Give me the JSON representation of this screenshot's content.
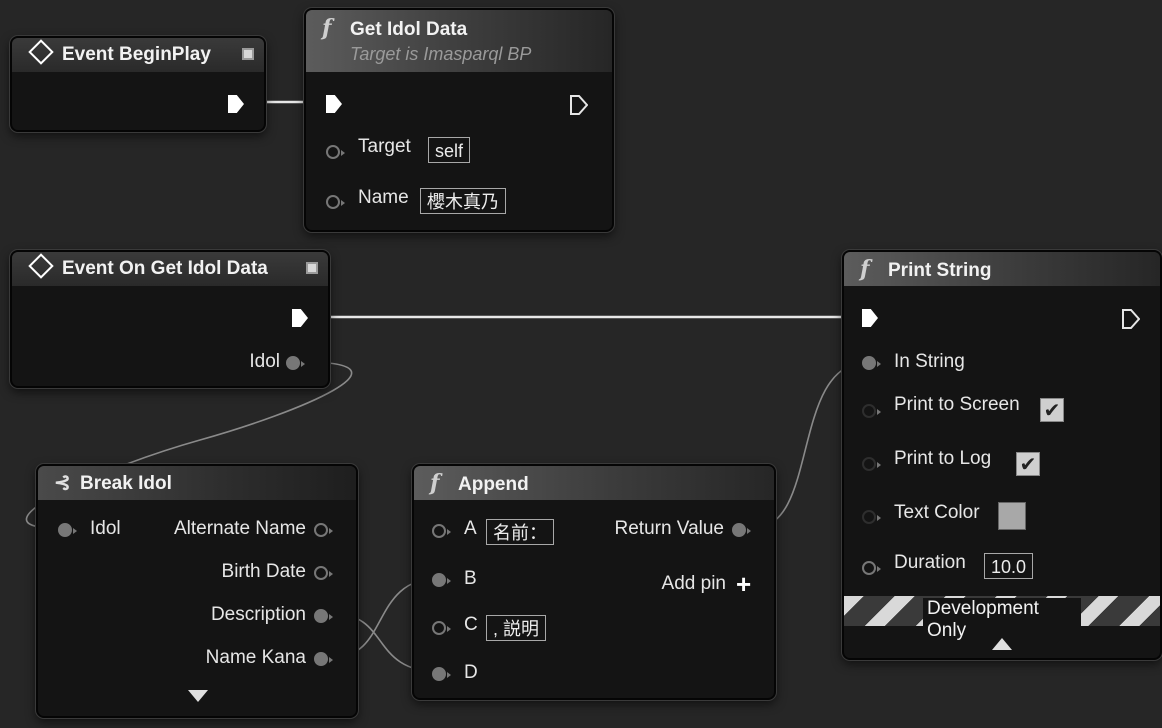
{
  "nodes": {
    "begin_play": {
      "title": "Event BeginPlay"
    },
    "get_idol_data": {
      "title": "Get Idol Data",
      "subtitle": "Target is Imasparql BP",
      "target_label": "Target",
      "target_value": "self",
      "name_label": "Name",
      "name_value": "櫻木真乃"
    },
    "on_get_idol_data": {
      "title": "Event On Get Idol Data",
      "idol_label": "Idol"
    },
    "print_string": {
      "title": "Print String",
      "in_string_label": "In String",
      "print_to_screen_label": "Print to Screen",
      "print_to_screen_checked": true,
      "print_to_log_label": "Print to Log",
      "print_to_log_checked": true,
      "text_color_label": "Text Color",
      "text_color_value": "#a8a8a8",
      "duration_label": "Duration",
      "duration_value": "10.0",
      "dev_only_label": "Development Only"
    },
    "break_idol": {
      "title": "Break Idol",
      "idol_label": "Idol",
      "alternate_name_label": "Alternate Name",
      "birth_date_label": "Birth Date",
      "description_label": "Description",
      "name_kana_label": "Name Kana"
    },
    "append": {
      "title": "Append",
      "a_label": "A",
      "a_value": "名前：",
      "b_label": "B",
      "c_label": "C",
      "c_value": ", 説明",
      "d_label": "D",
      "return_value_label": "Return Value",
      "add_pin_label": "Add pin"
    }
  },
  "icons": {
    "event": "diamond-icon",
    "function": "function-f-icon",
    "break": "break-struct-icon",
    "delegate": "delegate-square-icon",
    "add": "plus-icon",
    "expand": "triangle-down-icon",
    "collapse": "triangle-up-icon"
  },
  "colors": {
    "background": "#262626",
    "node_body": "#141414",
    "wire": "#e8e8e8",
    "data_pin": "#777777"
  }
}
